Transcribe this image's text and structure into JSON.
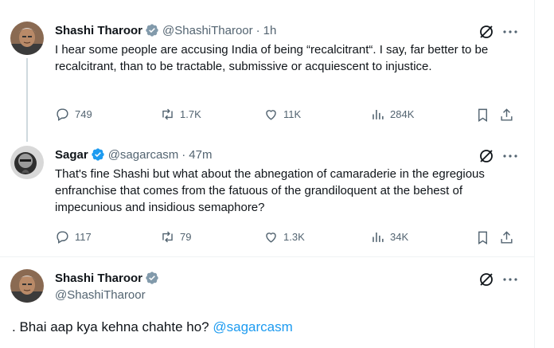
{
  "colors": {
    "accent": "#1d9bf0",
    "muted": "#536471",
    "text": "#0f1419"
  },
  "tweets": [
    {
      "author": "Shashi Tharoor",
      "handle": "@ShashiTharoor",
      "separator": "·",
      "time": "1h",
      "text": "I hear some people are accusing India of being “recalcitrant“. I say, far better to be recalcitrant, than to be tractable, submissive or acquiescent to injustice.",
      "stats": {
        "replies": "749",
        "retweets": "1.7K",
        "likes": "11K",
        "views": "284K"
      }
    },
    {
      "author": "Sagar",
      "handle": "@sagarcasm",
      "separator": "·",
      "time": "47m",
      "text": "That's fine Shashi but what about the abnegation of camaraderie in the egregious enfranchise that comes from the fatuous of the grandiloquent at the behest of impecunious and insidious semaphore?",
      "stats": {
        "replies": "117",
        "retweets": "79",
        "likes": "1.3K",
        "views": "34K"
      }
    }
  ],
  "focused": {
    "author": "Shashi Tharoor",
    "handle": "@ShashiTharoor",
    "text_prefix": ". Bhai aap kya kehna chahte ho? ",
    "mention": "@sagarcasm"
  },
  "icons": [
    "verified-badge-icon",
    "grok-icon",
    "more-icon",
    "reply-icon",
    "retweet-icon",
    "like-icon",
    "views-icon",
    "bookmark-icon",
    "share-icon"
  ]
}
